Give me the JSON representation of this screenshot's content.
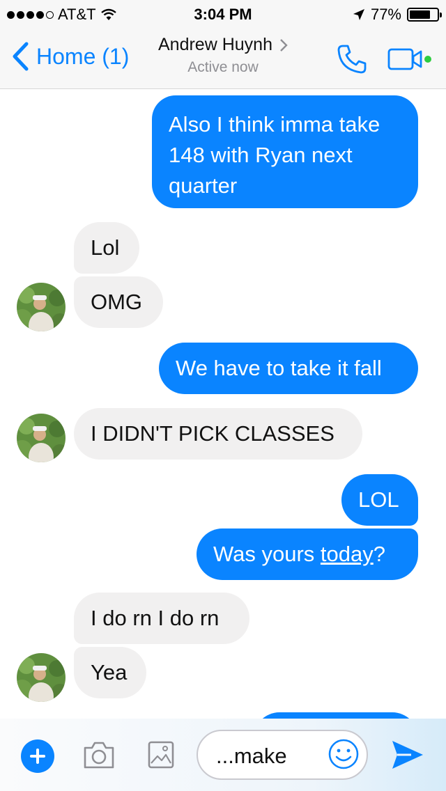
{
  "status_bar": {
    "carrier": "AT&T",
    "time": "3:04 PM",
    "battery_percent": "77%",
    "battery_level": 0.77
  },
  "nav": {
    "back_label": "Home (1)",
    "contact_name": "Andrew Huynh",
    "contact_status": "Active now"
  },
  "messages": [
    {
      "from": "me",
      "lines": [
        "Also I think imma take",
        "148 with Ryan next",
        "quarter"
      ]
    },
    {
      "from": "them",
      "text": "Lol"
    },
    {
      "from": "them",
      "text": "OMG"
    },
    {
      "from": "me",
      "text": "We have to take it fall"
    },
    {
      "from": "them",
      "text": "I DIDN'T PICK CLASSES"
    },
    {
      "from": "me",
      "text": "LOL"
    },
    {
      "from": "me",
      "prefix": "Was yours ",
      "link": "today",
      "suffix": "?"
    },
    {
      "from": "them",
      "text": "I do rn I do rn"
    },
    {
      "from": "them",
      "text": "Yea"
    }
  ],
  "input": {
    "value": "...make"
  },
  "colors": {
    "accent": "#0a84ff",
    "incoming_bubble": "#f1f0f0",
    "active_dot": "#2ecc40"
  }
}
